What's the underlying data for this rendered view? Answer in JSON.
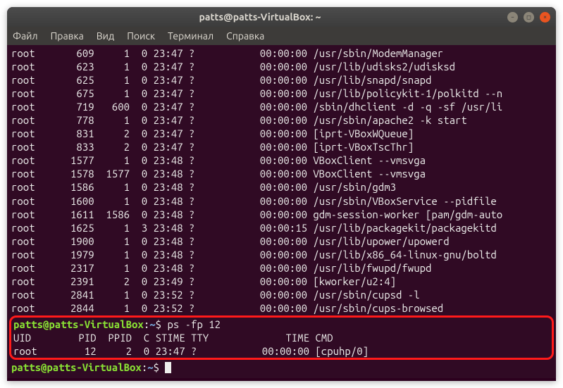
{
  "title": "patts@patts-VirtualBox: ~",
  "menu": {
    "file": "Файл",
    "edit": "Правка",
    "view": "Вид",
    "search": "Поиск",
    "terminal": "Терминал",
    "help": "Справка"
  },
  "processes": [
    {
      "user": "root",
      "pid": "609",
      "ppid": "1",
      "c": "0",
      "stime": "23:47",
      "tty": "?",
      "time": "00:00:00",
      "cmd": "/usr/sbin/ModemManager"
    },
    {
      "user": "root",
      "pid": "623",
      "ppid": "1",
      "c": "0",
      "stime": "23:47",
      "tty": "?",
      "time": "00:00:00",
      "cmd": "/usr/lib/udisks2/udisksd"
    },
    {
      "user": "root",
      "pid": "625",
      "ppid": "1",
      "c": "0",
      "stime": "23:47",
      "tty": "?",
      "time": "00:00:00",
      "cmd": "/usr/lib/snapd/snapd"
    },
    {
      "user": "root",
      "pid": "675",
      "ppid": "1",
      "c": "0",
      "stime": "23:47",
      "tty": "?",
      "time": "00:00:00",
      "cmd": "/usr/lib/policykit-1/polkitd --n"
    },
    {
      "user": "root",
      "pid": "719",
      "ppid": "600",
      "c": "0",
      "stime": "23:47",
      "tty": "?",
      "time": "00:00:00",
      "cmd": "/sbin/dhclient -d -q -sf /usr/li"
    },
    {
      "user": "root",
      "pid": "778",
      "ppid": "1",
      "c": "0",
      "stime": "23:47",
      "tty": "?",
      "time": "00:00:00",
      "cmd": "/usr/sbin/apache2 -k start"
    },
    {
      "user": "root",
      "pid": "831",
      "ppid": "2",
      "c": "0",
      "stime": "23:47",
      "tty": "?",
      "time": "00:00:00",
      "cmd": "[iprt-VBoxWQueue]"
    },
    {
      "user": "root",
      "pid": "833",
      "ppid": "2",
      "c": "0",
      "stime": "23:47",
      "tty": "?",
      "time": "00:00:00",
      "cmd": "[iprt-VBoxTscThr]"
    },
    {
      "user": "root",
      "pid": "1577",
      "ppid": "1",
      "c": "0",
      "stime": "23:48",
      "tty": "?",
      "time": "00:00:00",
      "cmd": "VBoxClient --vmsvga"
    },
    {
      "user": "root",
      "pid": "1578",
      "ppid": "1577",
      "c": "0",
      "stime": "23:48",
      "tty": "?",
      "time": "00:00:00",
      "cmd": "VBoxClient --vmsvga"
    },
    {
      "user": "root",
      "pid": "1586",
      "ppid": "1",
      "c": "0",
      "stime": "23:48",
      "tty": "?",
      "time": "00:00:00",
      "cmd": "/usr/sbin/gdm3"
    },
    {
      "user": "root",
      "pid": "1600",
      "ppid": "1",
      "c": "0",
      "stime": "23:48",
      "tty": "?",
      "time": "00:00:00",
      "cmd": "/usr/sbin/VBoxService --pidfile"
    },
    {
      "user": "root",
      "pid": "1611",
      "ppid": "1586",
      "c": "0",
      "stime": "23:48",
      "tty": "?",
      "time": "00:00:00",
      "cmd": "gdm-session-worker [pam/gdm-auto"
    },
    {
      "user": "root",
      "pid": "1625",
      "ppid": "1",
      "c": "3",
      "stime": "23:48",
      "tty": "?",
      "time": "00:00:15",
      "cmd": "/usr/lib/packagekit/packagekitd"
    },
    {
      "user": "root",
      "pid": "1900",
      "ppid": "1",
      "c": "0",
      "stime": "23:48",
      "tty": "?",
      "time": "00:00:00",
      "cmd": "/usr/lib/upower/upowerd"
    },
    {
      "user": "root",
      "pid": "1979",
      "ppid": "1",
      "c": "0",
      "stime": "23:48",
      "tty": "?",
      "time": "00:00:00",
      "cmd": "/usr/lib/x86_64-linux-gnu/boltd"
    },
    {
      "user": "root",
      "pid": "2317",
      "ppid": "1",
      "c": "0",
      "stime": "23:48",
      "tty": "?",
      "time": "00:00:00",
      "cmd": "/usr/lib/fwupd/fwupd"
    },
    {
      "user": "root",
      "pid": "2391",
      "ppid": "2",
      "c": "0",
      "stime": "23:49",
      "tty": "?",
      "time": "00:00:00",
      "cmd": "[kworker/u2:4]"
    },
    {
      "user": "root",
      "pid": "2841",
      "ppid": "1",
      "c": "0",
      "stime": "23:52",
      "tty": "?",
      "time": "00:00:00",
      "cmd": "/usr/sbin/cupsd -l"
    },
    {
      "user": "root",
      "pid": "2844",
      "ppid": "1",
      "c": "0",
      "stime": "23:52",
      "tty": "?",
      "time": "00:00:00",
      "cmd": "/usr/sbin/cups-browsed"
    }
  ],
  "prompt": {
    "userhost": "patts@patts-VirtualBox",
    "sep1": ":",
    "path": "~",
    "sep2": "$"
  },
  "command1": "ps -fp 12",
  "header": {
    "uid": "UID",
    "pid": "PID",
    "ppid": "PPID",
    "c": "C",
    "stime": "STIME",
    "tty": "TTY",
    "time": "TIME",
    "cmd": "CMD"
  },
  "result": {
    "uid": "root",
    "pid": "12",
    "ppid": "2",
    "c": "0",
    "stime": "23:47",
    "tty": "?",
    "time": "00:00:00",
    "cmd": "[cpuhp/0]"
  }
}
